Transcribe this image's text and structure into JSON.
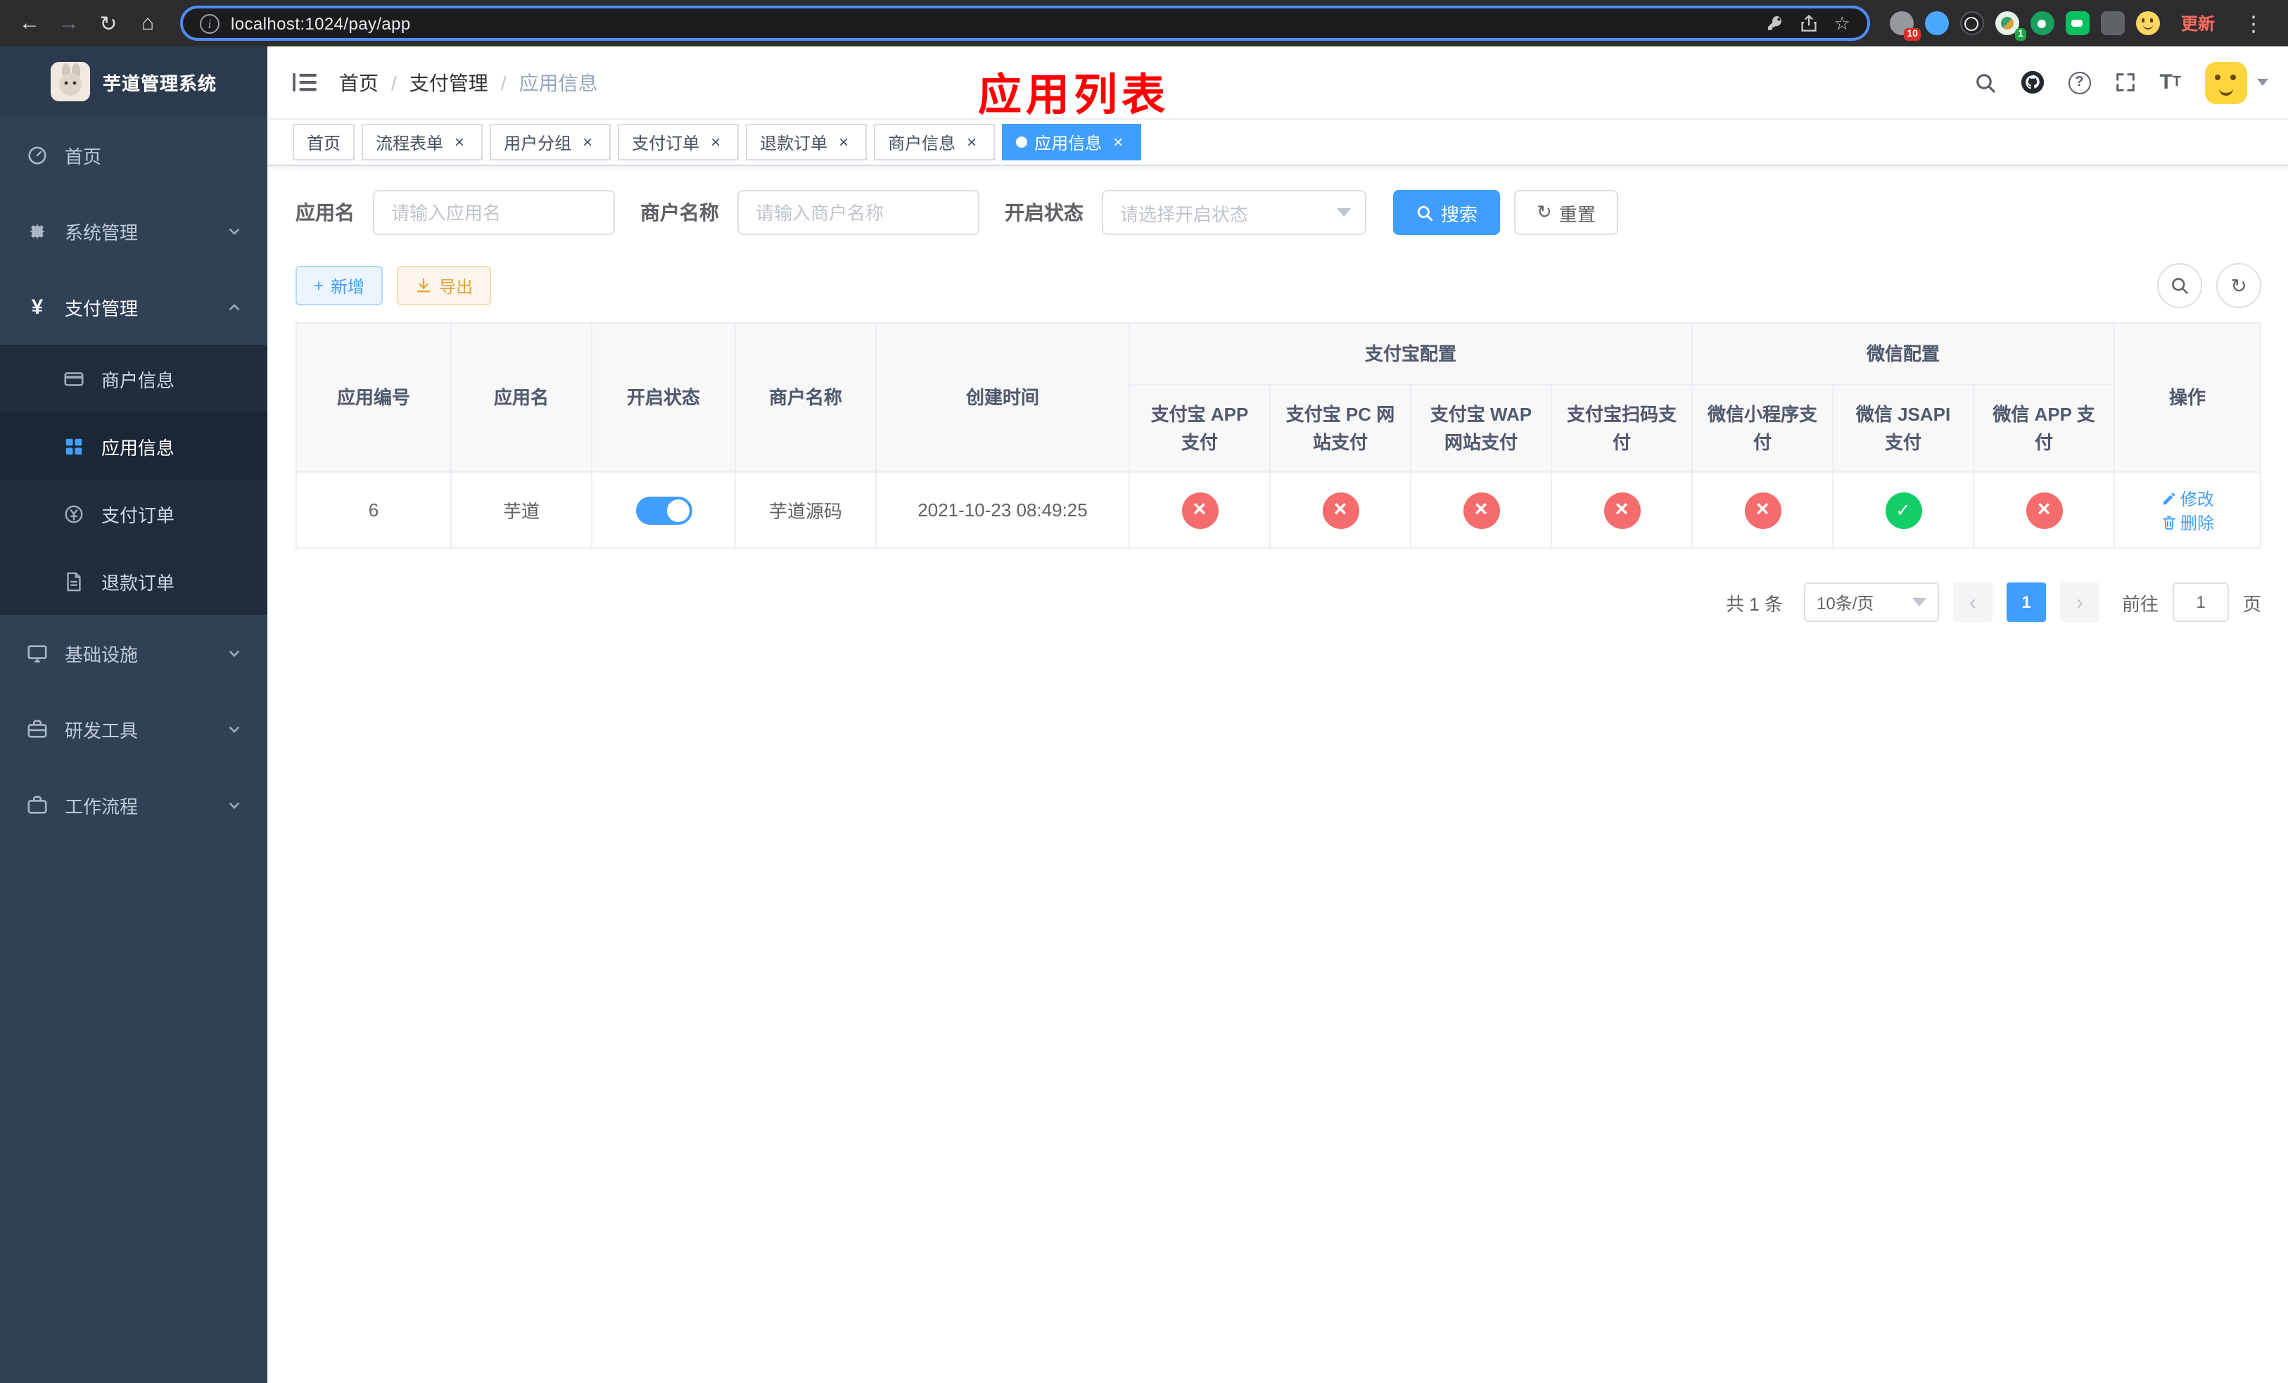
{
  "browser": {
    "url": "localhost:1024/pay/app",
    "update_label": "更新",
    "badge_10": "10",
    "badge_1": "1"
  },
  "glyphs": {
    "back": "←",
    "forward": "→",
    "reload": "↻",
    "home": "⌂",
    "info": "i",
    "star": "☆",
    "menu_dots": "⋮",
    "sep": "/",
    "close": "×",
    "plus": "+",
    "refresh": "↻",
    "prev": "‹",
    "next": "›",
    "question": "?",
    "yen": "¥",
    "text_size": "T"
  },
  "sidebar": {
    "title": "芋道管理系统",
    "home": "首页",
    "system": "系统管理",
    "pay": "支付管理",
    "pay_children": [
      "商户信息",
      "应用信息",
      "支付订单",
      "退款订单"
    ],
    "infra": "基础设施",
    "devtools": "研发工具",
    "workflow": "工作流程"
  },
  "header": {
    "breadcrumb": [
      "首页",
      "支付管理",
      "应用信息"
    ],
    "banner": "应用列表"
  },
  "tabs": [
    "首页",
    "流程表单",
    "用户分组",
    "支付订单",
    "退款订单",
    "商户信息",
    "应用信息"
  ],
  "filters": {
    "app_name_label": "应用名",
    "app_name_placeholder": "请输入应用名",
    "merchant_label": "商户名称",
    "merchant_placeholder": "请输入商户名称",
    "status_label": "开启状态",
    "status_placeholder": "请选择开启状态",
    "search": "搜索",
    "reset": "重置"
  },
  "toolbar_actions": {
    "add": "新增",
    "export": "导出"
  },
  "table": {
    "columns": [
      "应用编号",
      "应用名",
      "开启状态",
      "商户名称",
      "创建时间"
    ],
    "alipay_group": "支付宝配置",
    "alipay_columns": [
      "支付宝 APP 支付",
      "支付宝 PC 网站支付",
      "支付宝 WAP 网站支付",
      "支付宝扫码支付"
    ],
    "wechat_group": "微信配置",
    "wechat_columns": [
      "微信小程序支付",
      "微信 JSAPI 支付",
      "微信 APP 支付"
    ],
    "ops_column": "操作",
    "row": {
      "id": "6",
      "name": "芋道",
      "enabled": true,
      "merchant": "芋道源码",
      "created_at": "2021-10-23 08:49:25",
      "alipay_app": false,
      "alipay_pc": false,
      "alipay_wap": false,
      "alipay_qr": false,
      "wechat_lite": false,
      "wechat_jsapi": true,
      "wechat_app": false,
      "edit": "修改",
      "delete": "删除"
    }
  },
  "pagination": {
    "total": "共 1 条",
    "page_size": "10条/页",
    "page": "1",
    "goto_label": "前往",
    "goto_value": "1",
    "page_unit": "页"
  },
  "colors": {
    "accent": "#409eff",
    "danger": "#f56c6c",
    "success": "#13ce66",
    "warning": "#e6a23c",
    "banner_red": "#ff0000",
    "sidebar_bg": "#304156",
    "submenu_bg": "#1f2d3d"
  }
}
